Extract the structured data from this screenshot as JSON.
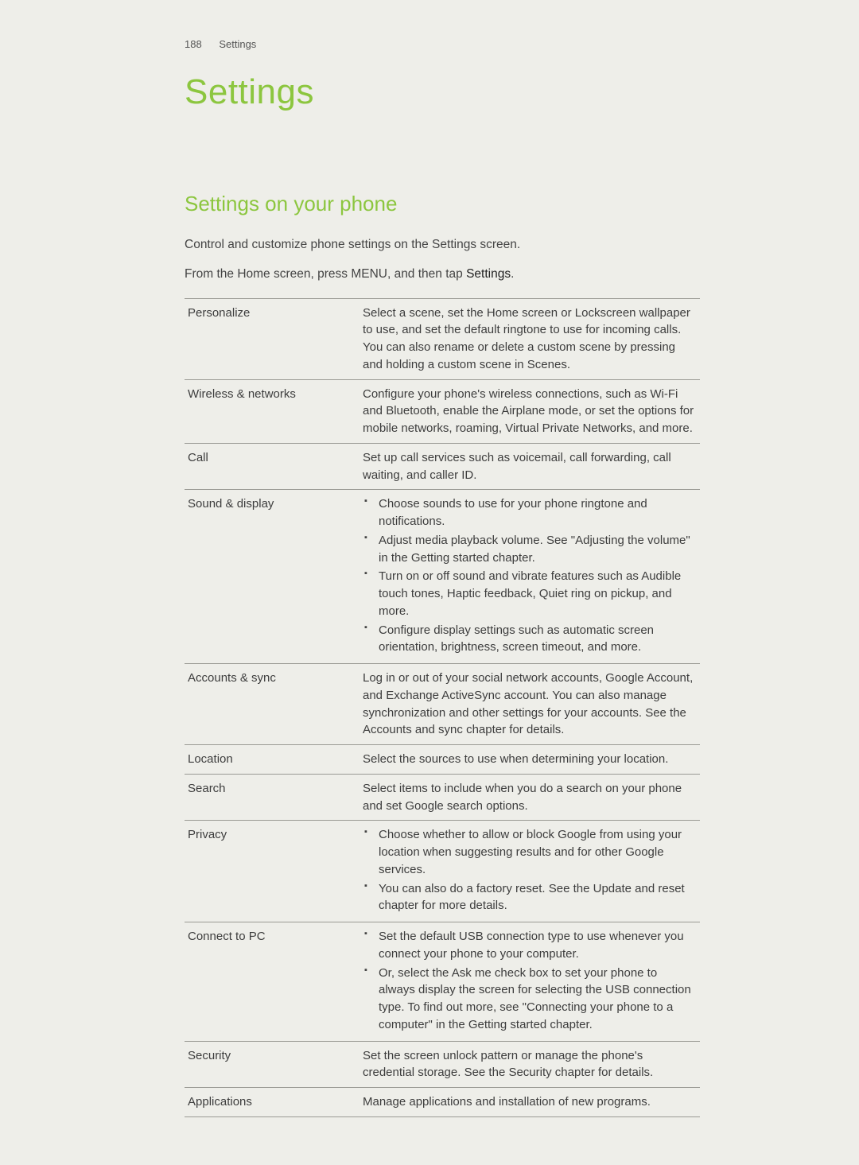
{
  "header": {
    "page_number": "188",
    "section": "Settings"
  },
  "title": "Settings",
  "subheading": "Settings on your phone",
  "intro_1": "Control and customize phone settings on the Settings screen.",
  "intro_2_prefix": "From the Home screen, press MENU, and then tap ",
  "intro_2_bold": "Settings",
  "intro_2_suffix": ".",
  "rows": [
    {
      "label": "Personalize",
      "type": "text",
      "text": "Select a scene, set the Home screen or Lockscreen wallpaper to use, and set the default ringtone to use for incoming calls. You can also rename or delete a custom scene by pressing and holding a custom scene in Scenes."
    },
    {
      "label": "Wireless & networks",
      "type": "text",
      "text": "Configure your phone's wireless connections, such as Wi-Fi and Bluetooth, enable the Airplane mode, or set the options for mobile networks, roaming, Virtual Private Networks, and more."
    },
    {
      "label": "Call",
      "type": "text",
      "text": "Set up call services such as voicemail, call forwarding, call waiting, and caller ID."
    },
    {
      "label": "Sound & display",
      "type": "bullets",
      "bullets": [
        "Choose sounds to use for your phone ringtone and notifications.",
        "Adjust media playback volume. See \"Adjusting the volume\" in the Getting started chapter.",
        "Turn on or off sound and vibrate features such as Audible touch tones, Haptic feedback, Quiet ring on pickup, and more.",
        "Configure display settings such as automatic screen orientation, brightness, screen timeout, and more."
      ]
    },
    {
      "label": "Accounts & sync",
      "type": "text",
      "text": "Log in or out of your social network accounts, Google Account, and Exchange ActiveSync account. You can also manage synchronization and other settings for your accounts. See the Accounts and sync chapter for details."
    },
    {
      "label": "Location",
      "type": "text",
      "text": "Select the sources to use when determining your location."
    },
    {
      "label": "Search",
      "type": "text",
      "text": "Select items to include when you do a search on your phone and set Google search options."
    },
    {
      "label": "Privacy",
      "type": "bullets",
      "bullets": [
        "Choose whether to allow or block Google from using your location when suggesting results and for other Google services.",
        "You can also do a factory reset. See the Update and reset chapter for more details."
      ]
    },
    {
      "label": "Connect to PC",
      "type": "bullets",
      "bullets": [
        "Set the default USB connection type to use whenever you connect your phone to your computer.",
        "Or, select the Ask me check box to set your phone to always display the screen for selecting the USB connection type. To find out more, see \"Connecting your phone to a computer\" in the Getting started chapter."
      ]
    },
    {
      "label": "Security",
      "type": "text",
      "text": "Set the screen unlock pattern or manage the phone's credential storage. See the Security chapter for details."
    },
    {
      "label": "Applications",
      "type": "text",
      "text": "Manage applications and installation of new programs."
    }
  ]
}
